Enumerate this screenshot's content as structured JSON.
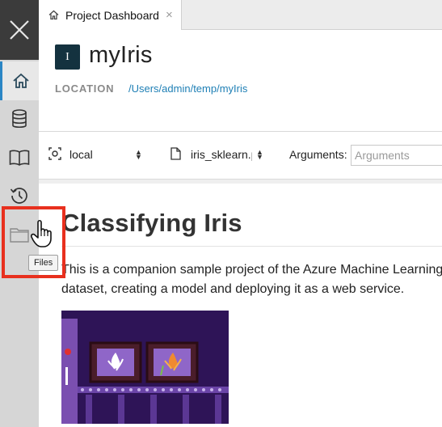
{
  "tabs": [
    {
      "label": "Project Dashboard",
      "icon": "home-icon",
      "active": true
    }
  ],
  "rail": {
    "items": [
      {
        "name": "home",
        "icon": "home-icon",
        "active": true
      },
      {
        "name": "data",
        "icon": "database-icon",
        "active": false
      },
      {
        "name": "notebooks",
        "icon": "book-icon",
        "active": false
      },
      {
        "name": "run-history",
        "icon": "history-icon",
        "active": false
      },
      {
        "name": "files",
        "icon": "folder-icon",
        "active": false
      }
    ]
  },
  "project": {
    "badge": "I",
    "name": "myIris",
    "location_label": "LOCATION",
    "location_value": "/Users/admin/temp/myIris"
  },
  "toolbar": {
    "target": "local",
    "file": "iris_sklearn.py",
    "arguments_label": "Arguments:",
    "arguments_placeholder": "Arguments",
    "arguments_value": ""
  },
  "document": {
    "title": "Classifying Iris",
    "line1": "This is a companion sample project of the Azure Machine Learning",
    "line2": "dataset, creating a model and deploying it as a web service."
  },
  "tooltip": "Files",
  "colors": {
    "accent": "#2b86c5",
    "highlight": "#e8301e",
    "badge": "#14323f",
    "link": "#1e7fb5"
  }
}
